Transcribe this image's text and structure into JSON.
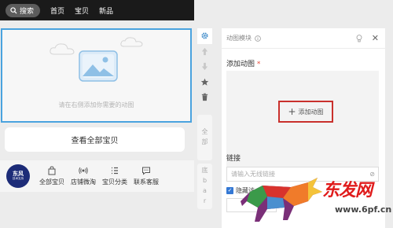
{
  "topbar": {
    "search_label": "搜索",
    "nav": [
      "首页",
      "宝贝",
      "新品"
    ]
  },
  "module": {
    "hint": "请在右侧添加你需要的动图"
  },
  "all_items_button": "查看全部宝贝",
  "bottom_nav": {
    "logo_text": "东风",
    "logo_subtext": "技术支持",
    "items": [
      {
        "label": "全部宝贝",
        "icon": "shopping-bag-icon"
      },
      {
        "label": "店铺微淘",
        "icon": "broadcast-icon"
      },
      {
        "label": "宝贝分类",
        "icon": "list-icon"
      },
      {
        "label": "联系客服",
        "icon": "chat-icon"
      }
    ]
  },
  "tools": [
    "gear-icon",
    "arrow-up-icon",
    "arrow-down-icon",
    "star-icon",
    "trash-icon"
  ],
  "vtabs": [
    "全部",
    "底bar"
  ],
  "panel": {
    "title": "动图模块",
    "add_label": "添加动图",
    "required_mark": "*",
    "add_button": "添加动图",
    "link_label": "链接",
    "link_placeholder": "请输入无线链接",
    "hide_label": "隐藏该",
    "hide_checked": true
  },
  "watermark": {
    "title": "东发网",
    "url": "www.6pf.cn"
  },
  "colors": {
    "accent": "#4aa3df",
    "highlight": "#c9302c",
    "topbar": "#1a1a1a",
    "checkbox": "#3478d4"
  }
}
